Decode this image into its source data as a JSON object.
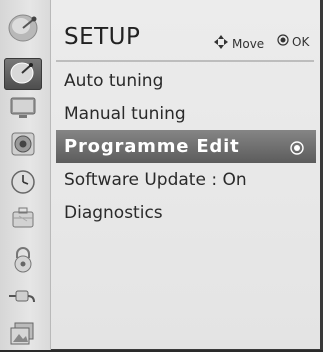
{
  "header": {
    "title": "SETUP",
    "move_hint": "Move",
    "ok_hint": "OK"
  },
  "sidebar": {
    "items": [
      {
        "icon": "satellite-dish-icon",
        "active": true
      },
      {
        "icon": "tv-screen-icon"
      },
      {
        "icon": "speaker-icon"
      },
      {
        "icon": "clock-icon"
      },
      {
        "icon": "briefcase-icon"
      },
      {
        "icon": "lock-icon"
      },
      {
        "icon": "input-connector-icon"
      },
      {
        "icon": "photo-media-icon"
      }
    ]
  },
  "menu": {
    "items": [
      {
        "label": "Auto tuning"
      },
      {
        "label": "Manual tuning"
      },
      {
        "label": "Programme Edit",
        "selected": true
      },
      {
        "label": "Software Update : On"
      },
      {
        "label": "Diagnostics"
      }
    ]
  },
  "colors": {
    "selection": "#6e6e6e",
    "background": "#e8e8e8",
    "text": "#2a2a2a"
  }
}
